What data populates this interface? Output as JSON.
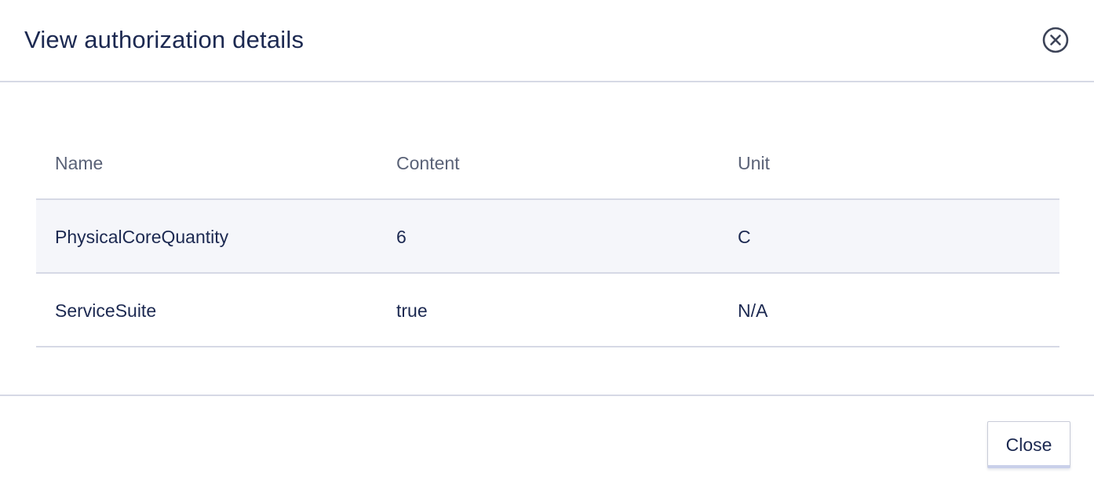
{
  "dialog": {
    "title": "View authorization details",
    "close_icon": "close-circle-icon"
  },
  "table": {
    "columns": [
      "Name",
      "Content",
      "Unit"
    ],
    "rows": [
      {
        "name": "PhysicalCoreQuantity",
        "content": "6",
        "unit": "C"
      },
      {
        "name": "ServiceSuite",
        "content": "true",
        "unit": "N/A"
      }
    ]
  },
  "footer": {
    "close_label": "Close"
  },
  "colors": {
    "text": "#1c2951",
    "header_text": "#5a6277",
    "divider": "#d6d9e5",
    "row_highlight": "#f5f6fa"
  }
}
